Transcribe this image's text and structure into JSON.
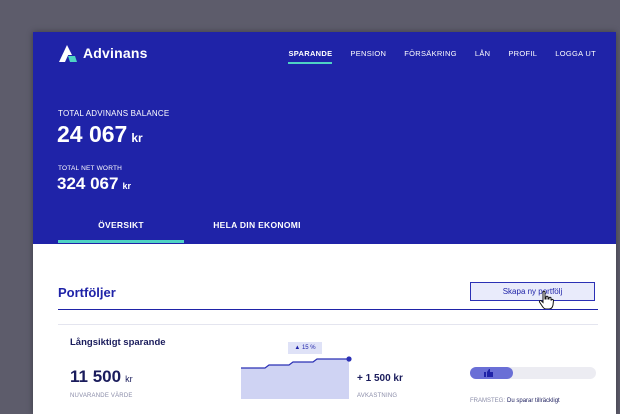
{
  "app": {
    "brand": "Advinans"
  },
  "nav": {
    "items": [
      {
        "label": "SPARANDE",
        "active": true
      },
      {
        "label": "PENSION",
        "active": false
      },
      {
        "label": "FÖRSÄKRING",
        "active": false
      },
      {
        "label": "LÅN",
        "active": false
      },
      {
        "label": "PROFIL",
        "active": false
      },
      {
        "label": "LOGGA UT",
        "active": false
      }
    ]
  },
  "summary": {
    "balance_label": "TOTAL ADVINANS BALANCE",
    "balance_value": "24 067",
    "balance_unit": "kr",
    "networth_label": "TOTAL NET WORTH",
    "networth_value": "324 067",
    "networth_unit": "kr"
  },
  "tabs": [
    {
      "label": "ÖVERSIKT",
      "active": true
    },
    {
      "label": "HELA DIN EKONOMI",
      "active": false
    }
  ],
  "portfolios": {
    "heading": "Portföljer",
    "create_button": "Skapa ny portfölj",
    "items": [
      {
        "title": "Långsiktigt sparande",
        "value": "11 500",
        "unit": "kr",
        "value_label": "NUVARANDE VÄRDE",
        "growth_badge": "▲ 15 %",
        "return_value": "+ 1 500 kr",
        "return_label": "AVKASTNING",
        "progress_fraction": 0.34,
        "progress_label": "FRAMSTEG:",
        "progress_text": "Du sparar tillräckligt"
      }
    ]
  },
  "colors": {
    "hero_bg": "#1f23a8",
    "accent": "#4fd3c4",
    "chart_fill": "#cfd3f3",
    "chart_line": "#2b30b5",
    "progress_fill": "#6a6fd6"
  },
  "icons": {
    "logo": "advinans-logo-icon",
    "cursor": "hand-pointer-icon",
    "progress": "thumbs-up-icon"
  }
}
